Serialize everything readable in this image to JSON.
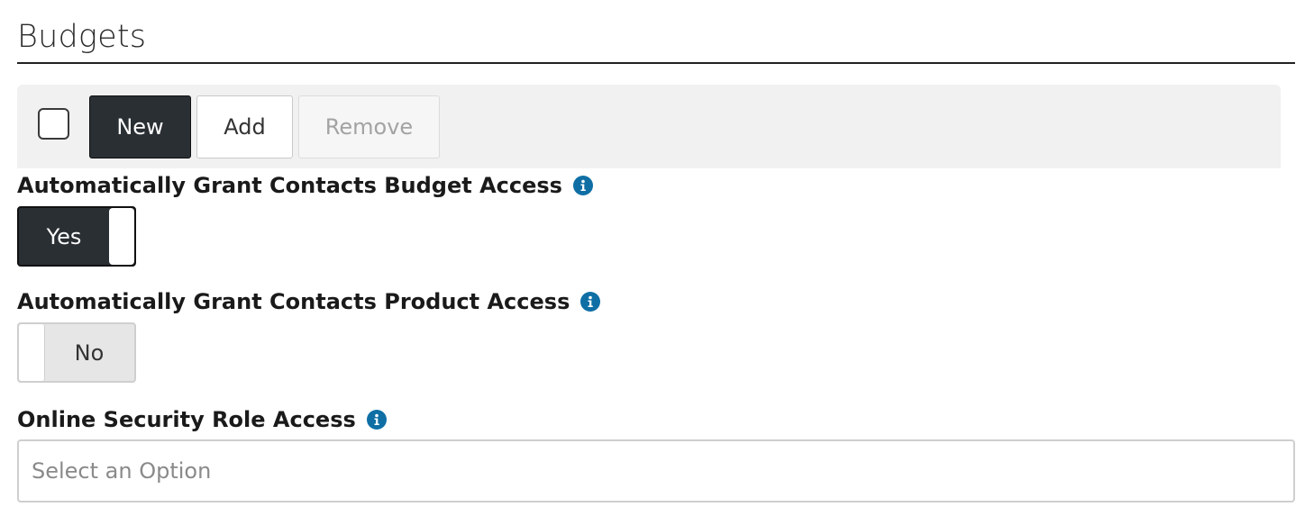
{
  "section": {
    "title": "Budgets"
  },
  "toolbar": {
    "new_label": "New",
    "add_label": "Add",
    "remove_label": "Remove"
  },
  "fields": {
    "budget_access": {
      "label": "Automatically Grant Contacts Budget Access",
      "value": "Yes"
    },
    "product_access": {
      "label": "Automatically Grant Contacts Product Access",
      "value": "No"
    },
    "security_role": {
      "label": "Online Security Role Access",
      "placeholder": "Select an Option"
    }
  },
  "colors": {
    "info_icon": "#0f6fa5",
    "toggle_on": "#2a2f34",
    "primary_button": "#2a2f34"
  },
  "icons": {
    "info": "info-circle-icon"
  }
}
